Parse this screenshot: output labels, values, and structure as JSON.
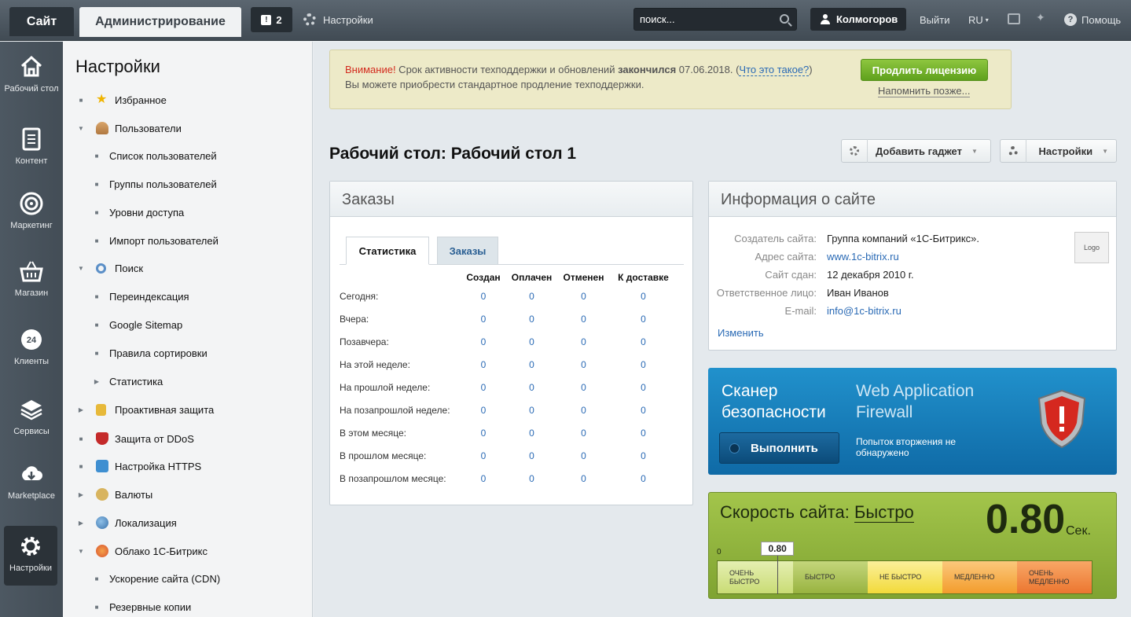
{
  "topbar": {
    "site_tab": "Сайт",
    "admin_tab": "Администрирование",
    "notifications_count": "2",
    "settings_label": "Настройки",
    "search_placeholder": "поиск...",
    "user_name": "Колмогоров",
    "logout": "Выйти",
    "language": "RU",
    "help": "Помощь"
  },
  "iconbar": {
    "items": [
      {
        "label": "Рабочий стол",
        "icon": "home-icon"
      },
      {
        "label": "Контент",
        "icon": "document-icon"
      },
      {
        "label": "Маркетинг",
        "icon": "target-icon"
      },
      {
        "label": "Магазин",
        "icon": "basket-icon"
      },
      {
        "label": "Клиенты",
        "icon": "clients-24-icon"
      },
      {
        "label": "Сервисы",
        "icon": "layers-icon"
      },
      {
        "label": "Marketplace",
        "icon": "cloud-download-icon"
      },
      {
        "label": "Настройки",
        "icon": "gear-icon"
      }
    ]
  },
  "nav": {
    "title": "Настройки",
    "items": [
      {
        "label": "Избранное"
      },
      {
        "label": "Пользователи"
      },
      {
        "label": "Список пользователей"
      },
      {
        "label": "Группы пользователей"
      },
      {
        "label": "Уровни доступа"
      },
      {
        "label": "Импорт пользователей"
      },
      {
        "label": "Поиск"
      },
      {
        "label": "Переиндексация"
      },
      {
        "label": "Google Sitemap"
      },
      {
        "label": "Правила сортировки"
      },
      {
        "label": "Статистика"
      },
      {
        "label": "Проактивная защита"
      },
      {
        "label": "Защита от DDoS"
      },
      {
        "label": "Настройка HTTPS"
      },
      {
        "label": "Валюты"
      },
      {
        "label": "Локализация"
      },
      {
        "label": "Облако 1С-Битрикс"
      },
      {
        "label": "Ускорение сайта (CDN)"
      },
      {
        "label": "Резервные копии"
      }
    ]
  },
  "warning": {
    "attention": "Внимание!",
    "text_a": " Срок активности техподдержки и обновлений ",
    "text_b": "закончился",
    "text_c": " 07.06.2018. (",
    "what_link": "Что это такое?",
    "text_d": ")",
    "line2": "Вы можете приобрести стандартное продление техподдержки.",
    "renew_button": "Продлить лицензию",
    "remind_link": "Напомнить позже..."
  },
  "page_title": "Рабочий стол: Рабочий стол 1",
  "add_gadget_button": "Добавить гаджет",
  "settings_button": "Настройки",
  "orders": {
    "title": "Заказы",
    "tabs": [
      "Статистика",
      "Заказы"
    ],
    "columns": [
      "Создан",
      "Оплачен",
      "Отменен",
      "К доставке"
    ],
    "rows": [
      {
        "label": "Сегодня:",
        "values": [
          "0",
          "0",
          "0",
          "0"
        ]
      },
      {
        "label": "Вчера:",
        "values": [
          "0",
          "0",
          "0",
          "0"
        ]
      },
      {
        "label": "Позавчера:",
        "values": [
          "0",
          "0",
          "0",
          "0"
        ]
      },
      {
        "label": "На этой неделе:",
        "values": [
          "0",
          "0",
          "0",
          "0"
        ]
      },
      {
        "label": "На прошлой неделе:",
        "values": [
          "0",
          "0",
          "0",
          "0"
        ]
      },
      {
        "label": "На позапрошлой неделе:",
        "values": [
          "0",
          "0",
          "0",
          "0"
        ]
      },
      {
        "label": "В этом месяце:",
        "values": [
          "0",
          "0",
          "0",
          "0"
        ]
      },
      {
        "label": "В прошлом месяце:",
        "values": [
          "0",
          "0",
          "0",
          "0"
        ]
      },
      {
        "label": "В позапрошлом месяце:",
        "values": [
          "0",
          "0",
          "0",
          "0"
        ]
      }
    ]
  },
  "site_info": {
    "title": "Информация о сайте",
    "rows": [
      {
        "key": "Создатель сайта:",
        "value": "Группа компаний «1С-Битрикс»."
      },
      {
        "key": "Адрес сайта:",
        "value": "www.1c-bitrix.ru"
      },
      {
        "key": "Сайт сдан:",
        "value": "12 декабря 2010 г."
      },
      {
        "key": "Ответственное лицо:",
        "value": "Иван Иванов"
      },
      {
        "key": "E-mail:",
        "value": "info@1c-bitrix.ru"
      }
    ],
    "logo": "Logo",
    "edit_link": "Изменить"
  },
  "scanner": {
    "title_line1": "Сканер",
    "title_line2": "безопасности",
    "run_button": "Выполнить",
    "waf_line1": "Web Application",
    "waf_line2": "Firewall",
    "waf_status_line1": "Попыток вторжения не",
    "waf_status_line2": "обнаружено"
  },
  "speed": {
    "label": "Скорость сайта:",
    "rating": "Быстро",
    "value": "0.80",
    "unit": "Сек.",
    "scale_zero": "0",
    "marker_value": "0.80",
    "marker_fraction": 0.16,
    "segments": [
      {
        "line1": "ОЧЕНЬ",
        "line2": "БЫСТРО"
      },
      {
        "line1": "БЫСТРО",
        "line2": ""
      },
      {
        "line1": "НЕ БЫСТРО",
        "line2": ""
      },
      {
        "line1": "МЕДЛЕННО",
        "line2": ""
      },
      {
        "line1": "ОЧЕНЬ",
        "line2": "МЕДЛЕННО"
      }
    ]
  }
}
